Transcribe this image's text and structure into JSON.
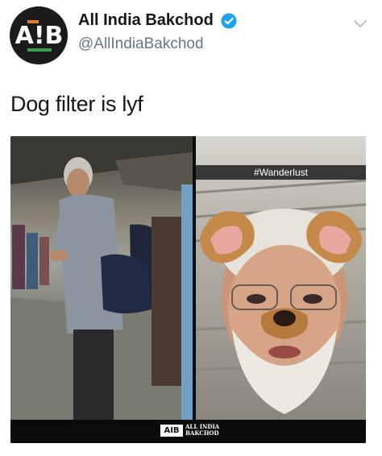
{
  "tweet": {
    "display_name": "All India Bakchod",
    "handle": "@AllIndiaBakchod",
    "text": "Dog filter is lyf",
    "avatar": {
      "logo_text": "AIB",
      "logo_left": "A",
      "logo_bang": "!",
      "logo_right": "B",
      "logo_bg": "#1b1b1b"
    },
    "verified_icon": "verified-badge-icon",
    "verified_color": "#1da1f2",
    "menu_icon": "chevron-down-icon"
  },
  "media": {
    "snap_caption": "#Wanderlust",
    "watermark": {
      "logo": "AIB",
      "line1": "ALL INDIA",
      "line2": "BAKCHOD"
    }
  }
}
